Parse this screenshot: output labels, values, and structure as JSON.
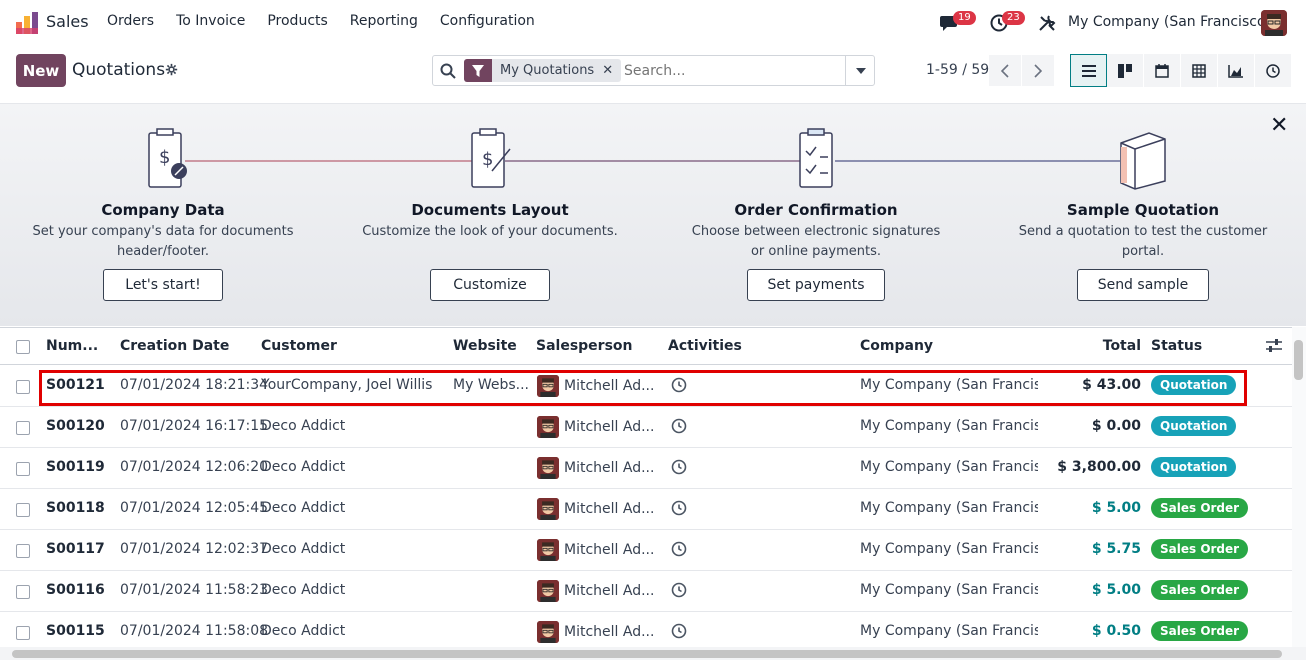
{
  "navbar": {
    "app_name": "Sales",
    "menu": [
      "Orders",
      "To Invoice",
      "Products",
      "Reporting",
      "Configuration"
    ],
    "messages_count": "19",
    "activities_count": "23",
    "company": "My Company (San Francisco)"
  },
  "control": {
    "new_label": "New",
    "title": "Quotations",
    "facet_label": "My Quotations",
    "search_placeholder": "Search...",
    "pager": "1-59 / 59"
  },
  "onboarding": {
    "steps": [
      {
        "title": "Company Data",
        "desc1": "Set your company's data for documents",
        "desc2": "header/footer.",
        "button": "Let's start!"
      },
      {
        "title": "Documents Layout",
        "desc1": "Customize the look of your documents.",
        "desc2": "",
        "button": "Customize"
      },
      {
        "title": "Order Confirmation",
        "desc1": "Choose between electronic signatures",
        "desc2": "or online payments.",
        "button": "Set payments"
      },
      {
        "title": "Sample Quotation",
        "desc1": "Send a quotation to test the customer",
        "desc2": "portal.",
        "button": "Send sample"
      }
    ]
  },
  "table": {
    "headers": {
      "number": "Num...",
      "creation_date": "Creation Date",
      "customer": "Customer",
      "website": "Website",
      "salesperson": "Salesperson",
      "activities": "Activities",
      "company": "Company",
      "total": "Total",
      "status": "Status"
    },
    "rows": [
      {
        "number": "S00121",
        "date": "07/01/2024 18:21:34",
        "customer": "YourCompany, Joel Willis",
        "website": "My Webs...",
        "salesperson": "Mitchell Ad...",
        "company": "My Company (San Francis...",
        "total": "$ 43.00",
        "status": "Quotation"
      },
      {
        "number": "S00120",
        "date": "07/01/2024 16:17:15",
        "customer": "Deco Addict",
        "website": "",
        "salesperson": "Mitchell Ad...",
        "company": "My Company (San Francis...",
        "total": "$ 0.00",
        "status": "Quotation"
      },
      {
        "number": "S00119",
        "date": "07/01/2024 12:06:20",
        "customer": "Deco Addict",
        "website": "",
        "salesperson": "Mitchell Ad...",
        "company": "My Company (San Francis...",
        "total": "$ 3,800.00",
        "status": "Quotation"
      },
      {
        "number": "S00118",
        "date": "07/01/2024 12:05:45",
        "customer": "Deco Addict",
        "website": "",
        "salesperson": "Mitchell Ad...",
        "company": "My Company (San Francis...",
        "total": "$ 5.00",
        "status": "Sales Order"
      },
      {
        "number": "S00117",
        "date": "07/01/2024 12:02:37",
        "customer": "Deco Addict",
        "website": "",
        "salesperson": "Mitchell Ad...",
        "company": "My Company (San Francis...",
        "total": "$ 5.75",
        "status": "Sales Order"
      },
      {
        "number": "S00116",
        "date": "07/01/2024 11:58:23",
        "customer": "Deco Addict",
        "website": "",
        "salesperson": "Mitchell Ad...",
        "company": "My Company (San Francis...",
        "total": "$ 5.00",
        "status": "Sales Order"
      },
      {
        "number": "S00115",
        "date": "07/01/2024 11:58:08",
        "customer": "Deco Addict",
        "website": "",
        "salesperson": "Mitchell Ad...",
        "company": "My Company (San Francis...",
        "total": "$ 0.50",
        "status": "Sales Order"
      }
    ]
  },
  "colors": {
    "brand": "#71445f",
    "teal": "#017e84",
    "quotation": "#17a2b8",
    "sales_order": "#28a745",
    "highlight": "#e00000"
  }
}
